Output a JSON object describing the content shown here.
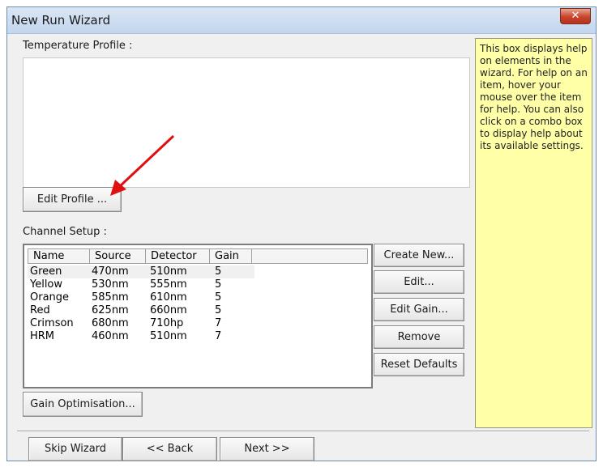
{
  "window": {
    "title": "New Run Wizard",
    "close_glyph": "✕"
  },
  "temperature_profile": {
    "label": "Temperature Profile :",
    "edit_button": "Edit Profile ..."
  },
  "help_text": "This box displays help on elements in the wizard. For help on an item, hover your mouse over the item for help. You can also click on a combo box to display help about its available settings.",
  "channel_setup": {
    "label": "Channel Setup :",
    "columns": [
      "Name",
      "Source",
      "Detector",
      "Gain"
    ],
    "rows": [
      {
        "name": "Green",
        "source": "470nm",
        "detector": "510nm",
        "gain": "5"
      },
      {
        "name": "Yellow",
        "source": "530nm",
        "detector": "555nm",
        "gain": "5"
      },
      {
        "name": "Orange",
        "source": "585nm",
        "detector": "610nm",
        "gain": "5"
      },
      {
        "name": "Red",
        "source": "625nm",
        "detector": "660nm",
        "gain": "5"
      },
      {
        "name": "Crimson",
        "source": "680nm",
        "detector": "710hp",
        "gain": "7"
      },
      {
        "name": "HRM",
        "source": "460nm",
        "detector": "510nm",
        "gain": "7"
      }
    ],
    "buttons": {
      "create_new": "Create New...",
      "edit": "Edit...",
      "edit_gain": "Edit Gain...",
      "remove": "Remove",
      "reset_defaults": "Reset Defaults"
    },
    "gain_optimisation": "Gain Optimisation..."
  },
  "footer": {
    "skip": "Skip Wizard",
    "back": "<< Back",
    "next": "Next >>"
  },
  "annotation": {
    "arrow_color": "#e01010"
  }
}
